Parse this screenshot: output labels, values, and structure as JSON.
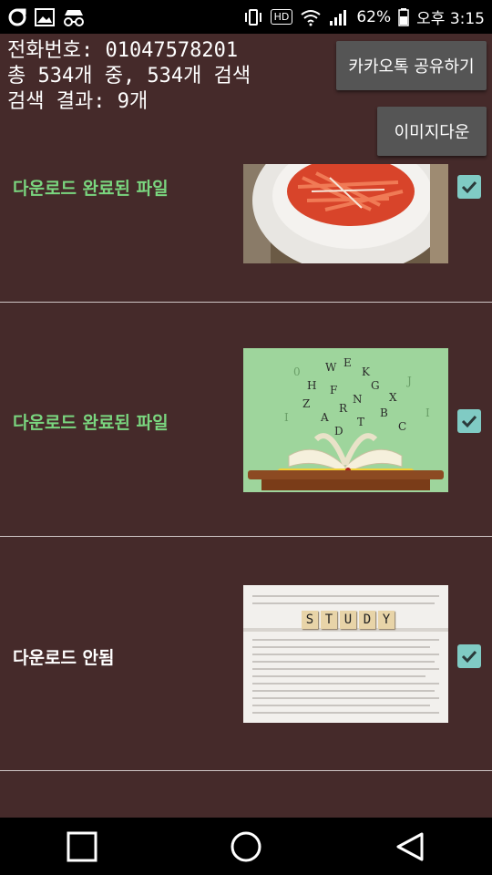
{
  "statusbar": {
    "battery_percent": "62%",
    "time": "오후 3:15",
    "hd_label": "HD"
  },
  "header": {
    "phone_line": "전화번호: 01047578201",
    "total_line": "총 534개 중, 534개 검색",
    "result_line": "검색 결과: 9개"
  },
  "buttons": {
    "share_label": "카카오톡 공유하기",
    "download_label": "이미지다운"
  },
  "rows": [
    {
      "status": "다운로드 완료된 파일",
      "status_color": "#7ad67f",
      "image": "food",
      "checked": true
    },
    {
      "status": "다운로드 완료된 파일",
      "status_color": "#7ad67f",
      "image": "book",
      "checked": true
    },
    {
      "status": "다운로드 안됨",
      "status_color": "#ffffff",
      "image": "study",
      "checked": true
    }
  ],
  "study_letters": [
    "S",
    "T",
    "U",
    "D",
    "Y"
  ],
  "colors": {
    "background": "#452a2a",
    "checkbox": "#80cbc4",
    "success_text": "#7ad67f"
  },
  "navbar": {
    "icons": [
      "square-icon",
      "circle-icon",
      "triangle-back-icon"
    ]
  }
}
